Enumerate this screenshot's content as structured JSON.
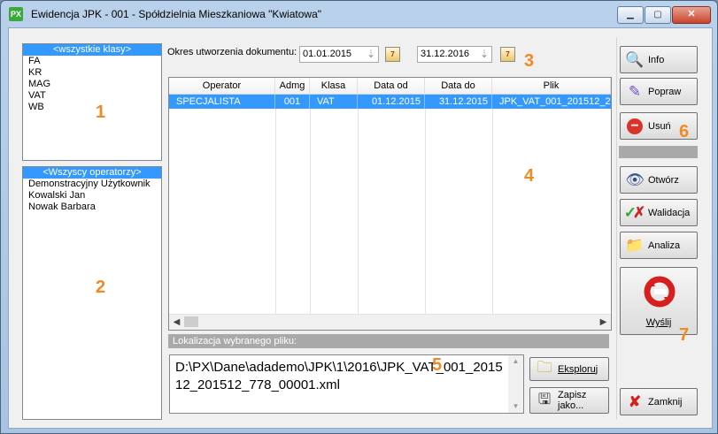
{
  "window": {
    "title": "Ewidencja JPK - 001 - Spółdzielnia Mieszkaniowa \"Kwiatowa\"",
    "app_icon_text": "PX",
    "min_label": "▁",
    "max_label": "▢",
    "close_label": "✕"
  },
  "classes": {
    "items": [
      "<wszystkie klasy>",
      "FA",
      "KR",
      "MAG",
      "VAT",
      "WB"
    ],
    "selected_index": 0
  },
  "operators": {
    "items": [
      "<Wszyscy operatorzy>",
      "Demonstracyjny Użytkownik",
      "Kowalski Jan",
      "Nowak Barbara"
    ],
    "selected_index": 0
  },
  "period": {
    "label": "Okres utworzenia dokumentu:",
    "from": "01.01.2015",
    "to": "31.12.2016"
  },
  "grid": {
    "columns": [
      "Operator",
      "Admg",
      "Klasa",
      "Data od",
      "Data do",
      "Plik"
    ],
    "rows": [
      {
        "operator": "SPECJALISTA",
        "admg": "001",
        "klasa": "VAT",
        "data_od": "01.12.2015",
        "data_do": "31.12.2015",
        "plik": "JPK_VAT_001_201512_2"
      }
    ]
  },
  "location": {
    "label": "Lokalizacja wybranego pliku:",
    "path": "D:\\PX\\Dane\\adademo\\JPK\\1\\2016\\JPK_VAT_001_201512_201512_778_00001.xml"
  },
  "buttons": {
    "explore": "Eksploruj",
    "save_as": "Zapisz jako...",
    "info": "Info",
    "edit": "Popraw",
    "delete": "Usuń",
    "open": "Otwórz",
    "validate": "Walidacja",
    "analyze": "Analiza",
    "send": "Wyślij",
    "close": "Zamknij"
  },
  "markers": [
    "1",
    "2",
    "3",
    "4",
    "5",
    "6",
    "7"
  ],
  "colors": {
    "selection": "#3399ff",
    "marker": "#f08a24",
    "header_bar": "#a9a9a9"
  }
}
